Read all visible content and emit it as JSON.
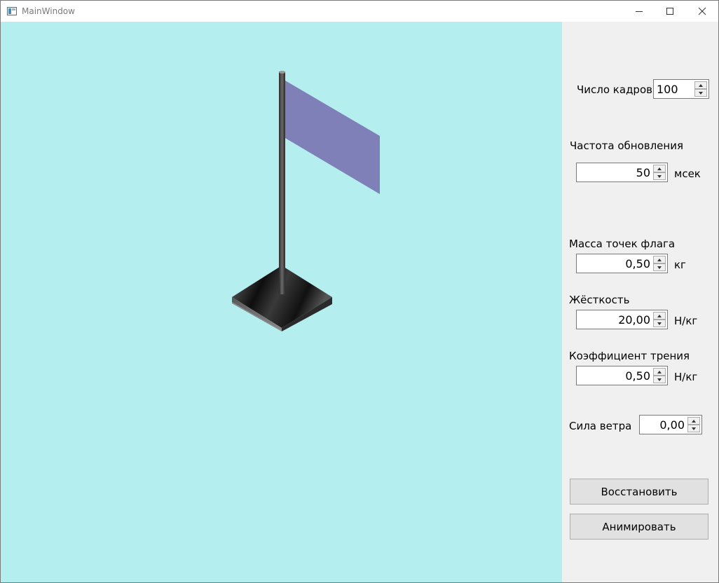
{
  "window": {
    "title": "MainWindow"
  },
  "panel": {
    "frames": {
      "label": "Число кадров",
      "value": "100"
    },
    "refresh": {
      "label": "Частота обновления",
      "value": "50",
      "unit": "мсек"
    },
    "mass": {
      "label": "Масса точек флага",
      "value": "0,50",
      "unit": "кг"
    },
    "stiffness": {
      "label": "Жёсткость",
      "value": "20,00",
      "unit": "Н/кг"
    },
    "friction": {
      "label": "Коэффициент трения",
      "value": "0,50",
      "unit": "Н/кг"
    },
    "wind": {
      "label": "Сила ветра",
      "value": "0,00"
    },
    "buttons": {
      "restore": "Восстановить",
      "animate": "Анимировать"
    }
  },
  "colors": {
    "background": "#b4eeee",
    "flag": "#8080b8",
    "pole": "#3a3a3a",
    "base": "#222222"
  }
}
